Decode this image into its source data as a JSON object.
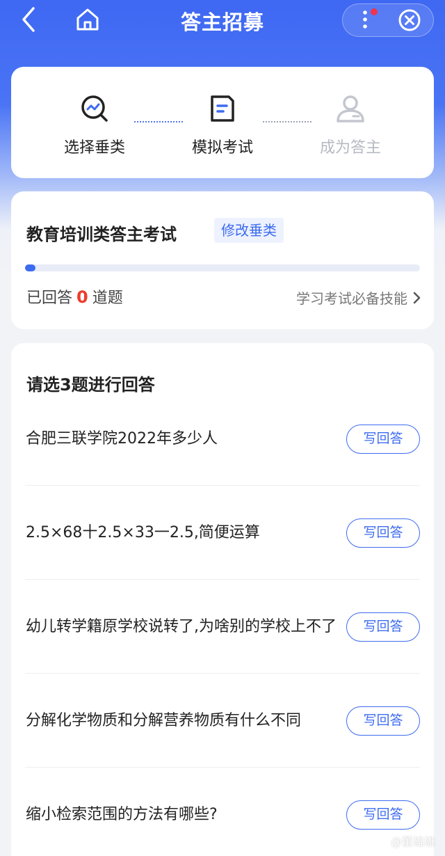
{
  "header": {
    "title": "答主招募"
  },
  "steps": [
    {
      "label": "选择垂类",
      "icon": "search-chart-icon",
      "state": "done"
    },
    {
      "label": "模拟考试",
      "icon": "document-icon",
      "state": "active"
    },
    {
      "label": "成为答主",
      "icon": "user-icon",
      "state": "disabled"
    }
  ],
  "exam": {
    "title": "教育培训类答主考试",
    "change_label": "修改垂类",
    "progress": 0.02,
    "answered_prefix": "已回答",
    "answered_count": "0",
    "answered_suffix": "道题",
    "skill_link": "学习考试必备技能"
  },
  "questions": {
    "heading": "请选3题进行回答",
    "button_label": "写回答",
    "items": [
      {
        "text": "合肥三联学院2022年多少人"
      },
      {
        "text": "2.5×68十2.5×33一2.5,简便运算"
      },
      {
        "text": "幼儿转学籍原学校说转了,为啥别的学校上不了"
      },
      {
        "text": "分解化学物质和分解营养物质有什么不同"
      },
      {
        "text": "缩小检索范围的方法有哪些?"
      }
    ]
  },
  "watermark": "@董雄雄",
  "colors": {
    "accent": "#3d6bf0",
    "count_red": "#ee3c2d",
    "header_blue": "#3f68f3"
  }
}
